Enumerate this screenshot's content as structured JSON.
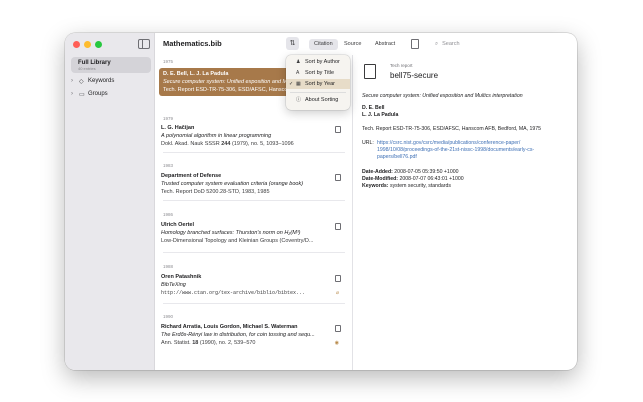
{
  "window": {
    "title": "Mathematics.bib",
    "traffic": [
      "#ff5f57",
      "#febc2e",
      "#28c840"
    ]
  },
  "sidebar": {
    "library": {
      "label": "Full Library",
      "sub": "40 entries"
    },
    "items": [
      {
        "label": "Keywords"
      },
      {
        "label": "Groups"
      }
    ]
  },
  "toolbar": {
    "tabs": [
      "Citation",
      "Source",
      "Abstract"
    ],
    "search_placeholder": "Search"
  },
  "sort_menu": {
    "items": [
      "Sort by Author",
      "Sort by Title",
      "Sort by Year",
      "About Sorting"
    ],
    "checked": "Sort by Year"
  },
  "list": {
    "years": [
      "1975",
      "1979",
      "1983",
      "1986",
      "1988",
      "1990"
    ],
    "entries": [
      {
        "authors": "D. E. Bell, L. J. La Padula",
        "title": "Secure computer system: Unified exposition and Multics",
        "pub": "Tech. Report ESD-TR-75-306, ESD/AFSC, Hanscom"
      },
      {
        "authors": "L. G. Hačijan",
        "title": "A polynomial algorithm in linear programming",
        "pub_pre": "Dokl. Akad. Nauk SSSR ",
        "pub_bold": "244",
        "pub_post": " (1979), no. 5, 1093–1096"
      },
      {
        "authors": "Department of Defense",
        "title": "Trusted computer system evaluation criteria (orange book)",
        "pub": "Tech. Report DoD 5200.28-STD, 1983, 1985"
      },
      {
        "authors": "Ulrich Oertel",
        "title": "Homology branched surfaces: Thurston's norm on H₂(M³)",
        "pub": "Low-Dimensional Topology and Kleinian Groups (Coventry/D..."
      },
      {
        "authors": "Oren Patashnik",
        "title": "BibTeXing",
        "pub": "http://www.ctan.org/tex-archive/biblio/bibtex..."
      },
      {
        "authors": "Richard Arratia, Louis Gordon, Michael S. Waterman",
        "title": "The Erdős-Rényi law in distribution, for coin tossing and sequ...",
        "pub_pre": "Ann. Statist. ",
        "pub_bold": "18",
        "pub_post": " (1990), no. 2, 539–570"
      }
    ]
  },
  "detail": {
    "kind": "Tech report",
    "key": "bell75-secure",
    "title": "Secure computer system: Unified exposition and Multics interpretation",
    "authors": [
      "D. E. Bell",
      "L. J. La Padula"
    ],
    "publication": "Tech. Report ESD-TR-75-306, ESD/AFSC, Hanscom AFB, Bedford, MA, 1975",
    "url_label": "URL:",
    "url_lines": [
      "https://csrc.nist.gov/csrc/media/publications/conference-paper/",
      "1998/10/08/proceedings-of-the-21st-nissc-1998/documents/early-cs-",
      "papers/bell76.pdf"
    ],
    "date_added_label": "Date-Added:",
    "date_added": "2008-07-05 05:39:50 +1000",
    "date_modified_label": "Date-Modified:",
    "date_modified": "2008-07-07 06:43:01 +1000",
    "keywords_label": "Keywords:",
    "keywords": "system security, standards"
  }
}
